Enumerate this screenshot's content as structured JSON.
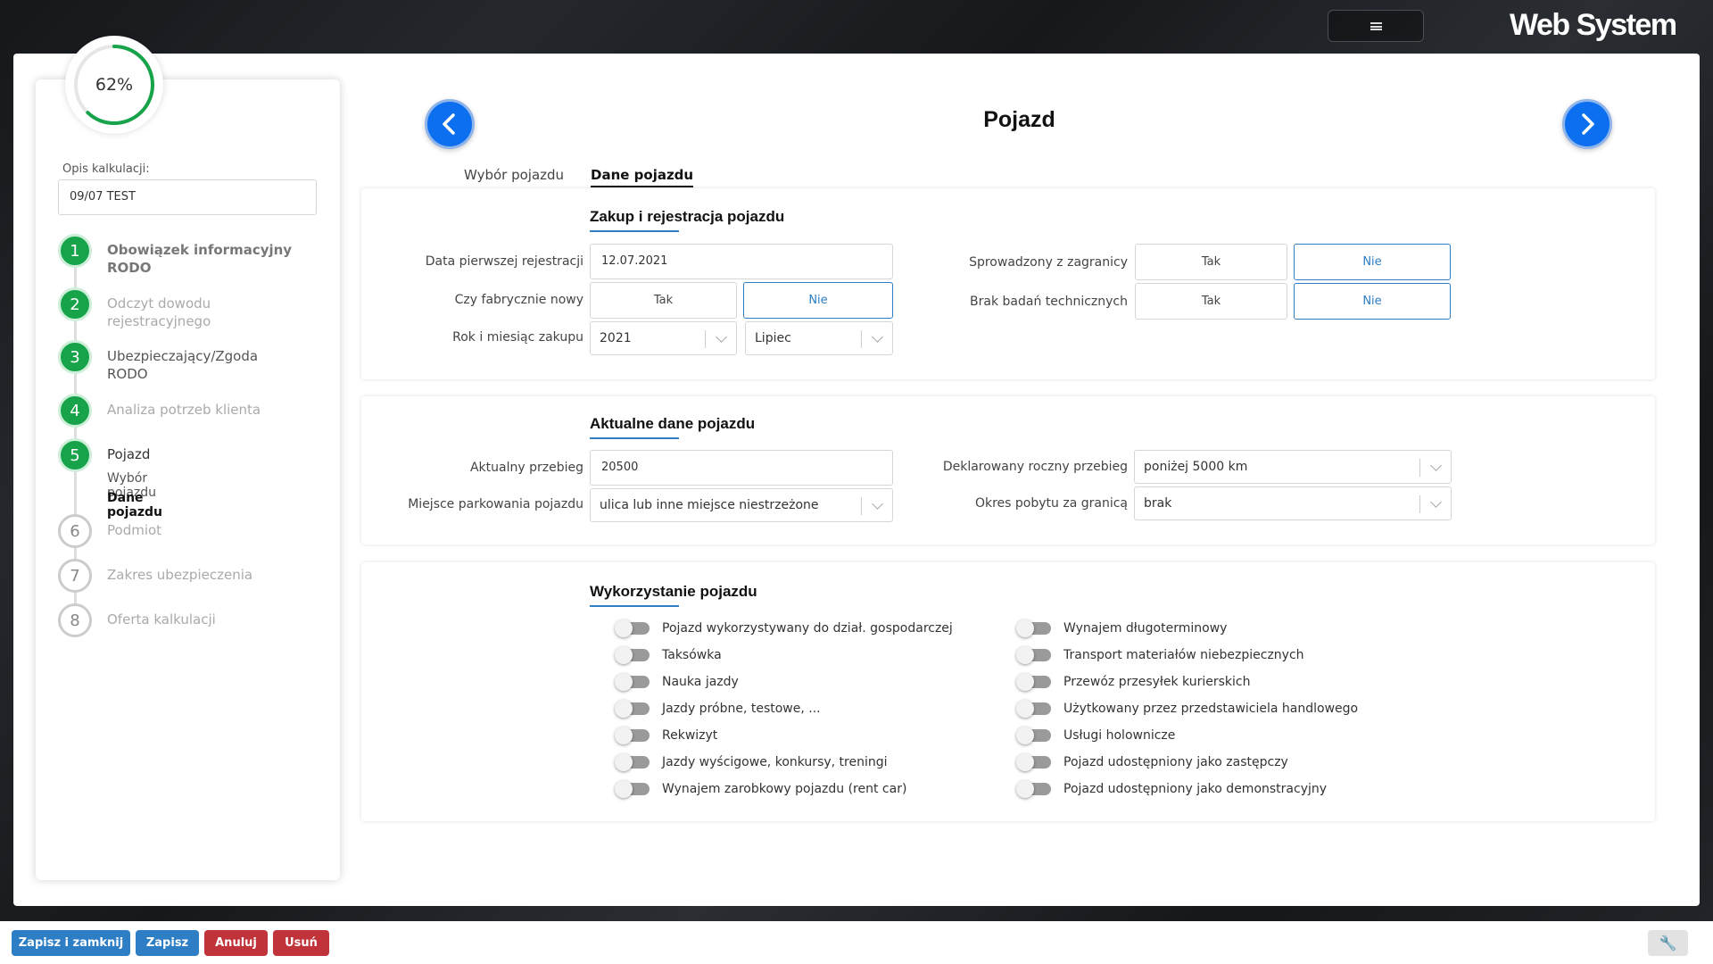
{
  "brand": {
    "logo": "Web System"
  },
  "progress": {
    "label": "62%",
    "value": 0.62,
    "color": "#16a34a"
  },
  "sidebar": {
    "description_label": "Opis kalkulacji:",
    "description_value": "09/07 TEST",
    "steps": [
      {
        "number": "1",
        "line1": "Obowiązek informacyjny",
        "line2": "RODO"
      },
      {
        "number": "2",
        "line1": "Odczyt dowodu",
        "line2": "rejestracyjnego"
      },
      {
        "number": "3",
        "line1": "Ubezpieczający/Zgoda",
        "line2": "RODO"
      },
      {
        "number": "4",
        "line1": "Analiza potrzeb klienta"
      },
      {
        "number": "5",
        "line1": "Pojazd",
        "sub": [
          "Wybór pojazdu",
          "Dane pojazdu"
        ]
      },
      {
        "number": "6",
        "line1": "Podmiot"
      },
      {
        "number": "7",
        "line1": "Zakres ubezpieczenia"
      },
      {
        "number": "8",
        "line1": "Oferta kalkulacji"
      }
    ]
  },
  "page": {
    "title": "Pojazd",
    "tabs": [
      "Wybór pojazdu",
      "Dane pojazdu"
    ]
  },
  "purchase": {
    "title": "Zakup i rejestracja pojazdu",
    "first_reg_label": "Data pierwszej rejestracji",
    "first_reg_value": "12.07.2021",
    "factory_new_label": "Czy fabrycznie nowy",
    "year_month_label": "Rok i miesiąc zakupu",
    "year_value": "2021",
    "month_value": "Lipiec",
    "imported_label": "Sprowadzony z zagranicy",
    "no_inspection_label": "Brak badań technicznych",
    "yes": "Tak",
    "no": "Nie"
  },
  "current": {
    "title": "Aktualne dane pojazdu",
    "mileage_label": "Aktualny przebieg",
    "mileage_value": "20500",
    "parking_label": "Miejsce parkowania pojazdu",
    "parking_value": "ulica lub inne miejsce niestrzeżone",
    "annual_label": "Deklarowany roczny przebieg",
    "annual_value": "poniżej 5000 km",
    "abroad_label": "Okres pobytu za granicą",
    "abroad_value": "brak"
  },
  "usage": {
    "title": "Wykorzystanie pojazdu",
    "left": [
      "Pojazd wykorzystywany do dział. gospodarczej",
      "Taksówka",
      "Nauka jazdy",
      "Jazdy próbne, testowe, ...",
      "Rekwizyt",
      "Jazdy wyścigowe, konkursy, treningi",
      "Wynajem zarobkowy pojazdu (rent car)"
    ],
    "right": [
      "Wynajem długoterminowy",
      "Transport materiałów niebezpiecznych",
      "Przewóz przesyłek kurierskich",
      "Użytkowany przez przedstawiciela handlowego",
      "Usługi holownicze",
      "Pojazd udostępniony jako zastępczy",
      "Pojazd udostępniony jako demonstracyjny"
    ]
  },
  "bottom": {
    "save_close": "Zapisz i zamknij",
    "save": "Zapisz",
    "cancel": "Anuluj",
    "delete": "Usuń"
  },
  "colors": {
    "accent": "#2d7ec4",
    "nav_arrow": "#0b6ff0",
    "danger": "#c0333b",
    "success": "#16a34a"
  }
}
